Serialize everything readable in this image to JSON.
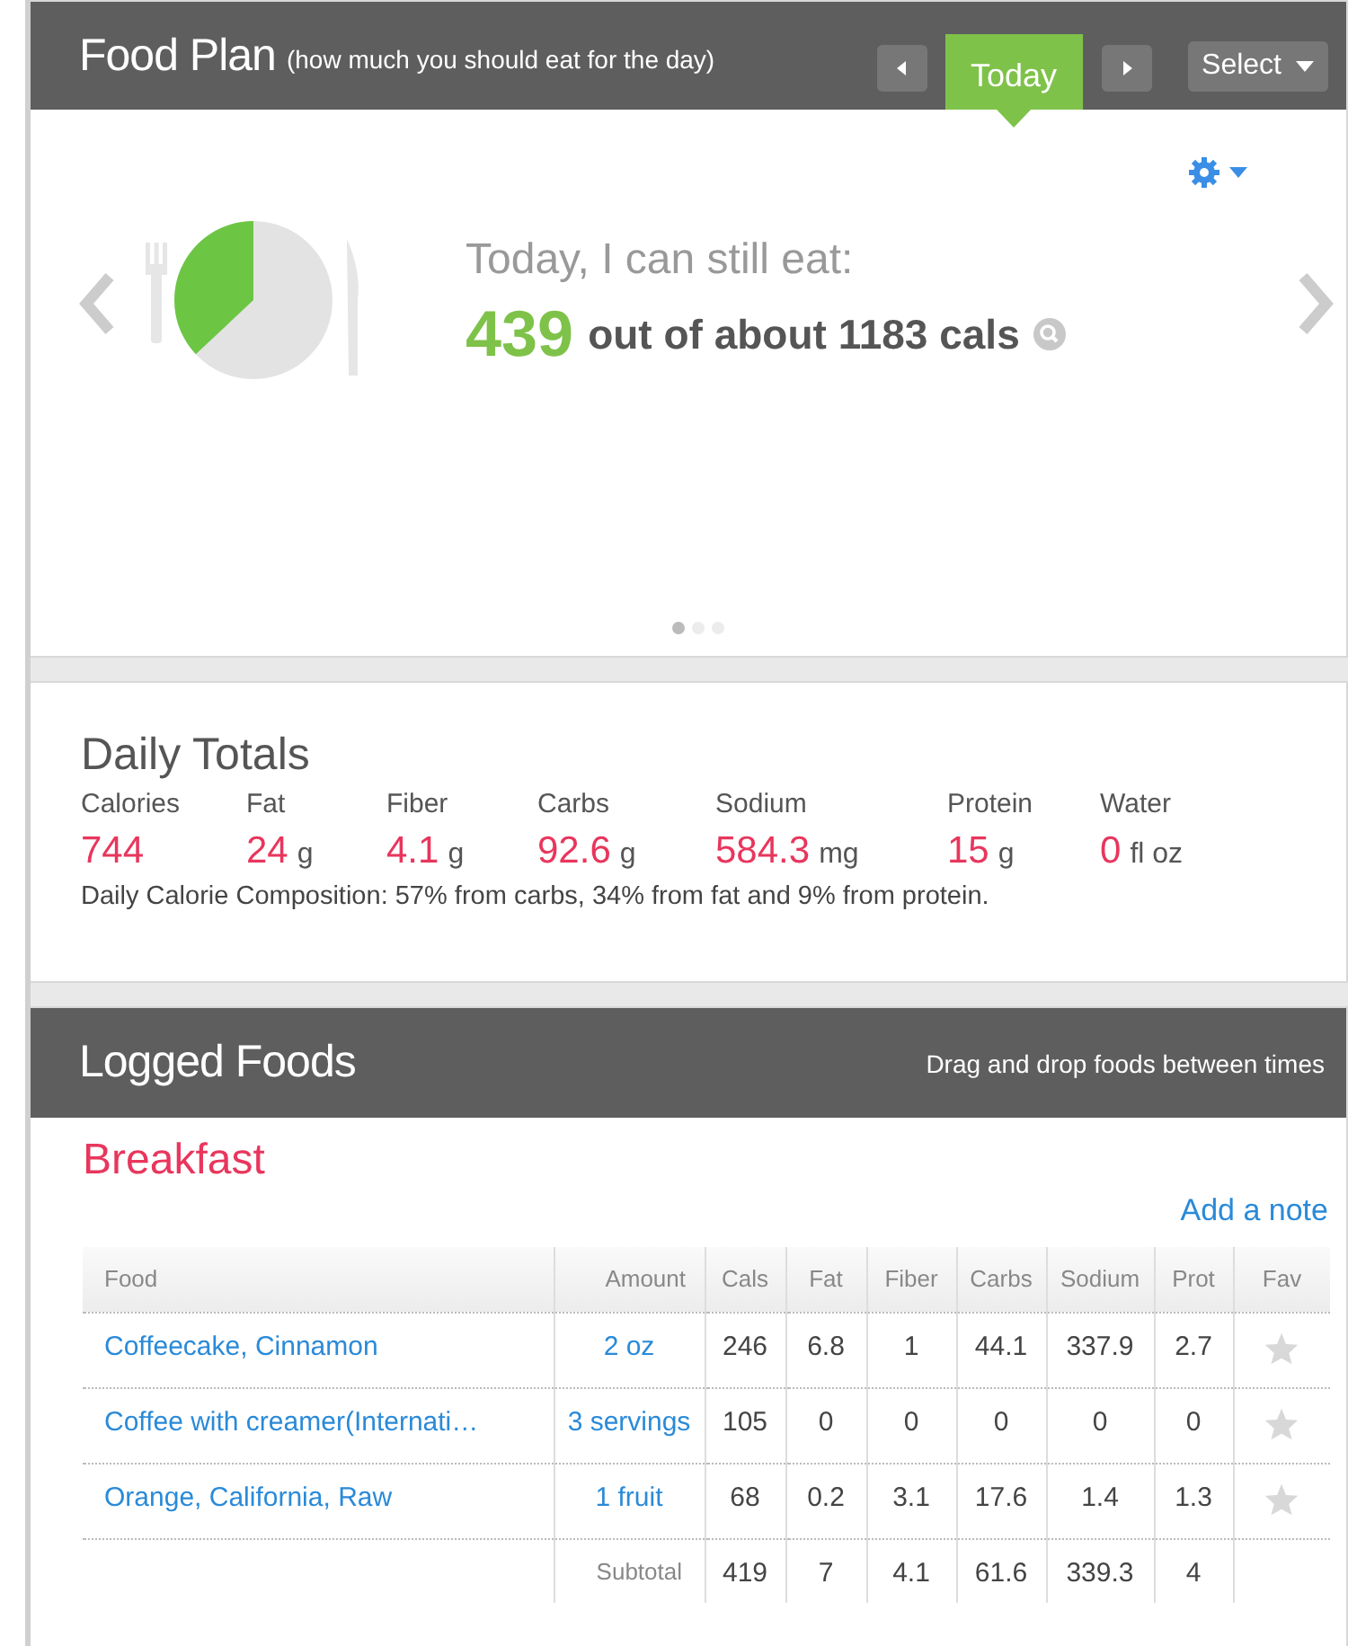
{
  "food_plan": {
    "title": "Food Plan",
    "subtitle": "(how much you should eat for the day)",
    "today_label": "Today",
    "select_label": "Select",
    "summary_label": "Today, I can still eat:",
    "remaining": "439",
    "of_total": "out of about 1183 cals",
    "plate_meter": {
      "level": 0.37
    },
    "pager": [
      {
        "selected": true
      },
      {
        "selected": false
      },
      {
        "selected": false
      }
    ]
  },
  "daily_totals": {
    "title": "Daily Totals",
    "stats": [
      {
        "label": "Calories",
        "value": "744"
      },
      {
        "label": "Fat",
        "value": "24",
        "unit": "g"
      },
      {
        "label": "Fiber",
        "value": "4.1",
        "unit": "g"
      },
      {
        "label": "Carbs",
        "value": "92.6",
        "unit": "g"
      },
      {
        "label": "Sodium",
        "value": "584.3",
        "unit": "mg"
      },
      {
        "label": "Protein",
        "value": "15",
        "unit": "g"
      },
      {
        "label": "Water",
        "value": "0",
        "unit": "fl oz"
      }
    ],
    "composition": "Daily Calorie Composition: 57% from carbs, 34% from fat and 9% from protein."
  },
  "logged_foods": {
    "title": "Logged Foods",
    "hint": "Drag and drop foods between times",
    "meals": [
      {
        "name": "Breakfast",
        "add_note": "Add a note",
        "columns": [
          "Food",
          "Amount",
          "Cals",
          "Fat",
          "Fiber",
          "Carbs",
          "Sodium",
          "Prot",
          "Fav"
        ],
        "rows": [
          {
            "food": "Coffeecake, Cinnamon",
            "amount": "2 oz",
            "values": [
              "246",
              "6.8",
              "1",
              "44.1",
              "337.9",
              "2.7"
            ],
            "favorite": false
          },
          {
            "food": "Coffee with creamer(Internati…",
            "amount": "3 servings",
            "values": [
              "105",
              "0",
              "0",
              "0",
              "0",
              "0"
            ],
            "favorite": false
          },
          {
            "food": "Orange, California, Raw",
            "amount": "1 fruit",
            "values": [
              "68",
              "0.2",
              "3.1",
              "17.6",
              "1.4",
              "1.3"
            ],
            "favorite": false
          }
        ],
        "subtotal": {
          "label": "Subtotal",
          "values": [
            "419",
            "7",
            "4.1",
            "61.6",
            "339.3",
            "4"
          ]
        }
      }
    ]
  }
}
